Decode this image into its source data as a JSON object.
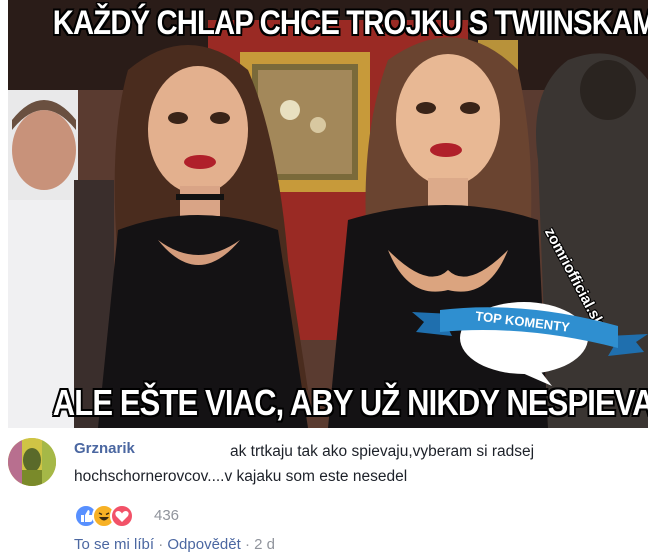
{
  "meme": {
    "top_caption": "KAŽDÝ CHLAP CHCE TROJKU S TWIINSKAMI",
    "bottom_caption": "ALE EŠTE VIAC, ABY UŽ NIKDY NESPIEVALI",
    "watermark": "zomriofficial.sk",
    "badge_label": "TOP KOMENTY"
  },
  "comment": {
    "author": "Grznarik",
    "text": "ak trtkaju tak ako spievaju,vyberam si radsej hochschornerovcov....v kajaku som este nesedel",
    "reaction_icons": [
      "like-icon",
      "haha-icon",
      "love-icon"
    ],
    "reaction_count": "436",
    "actions": {
      "like": "To se mi líbí",
      "reply": "Odpovědět",
      "separator": "·",
      "time": "2 d"
    }
  },
  "colors": {
    "link_blue": "#4b67a1",
    "meta_gray": "#90949c",
    "badge_blue": "#2f8fd0"
  }
}
